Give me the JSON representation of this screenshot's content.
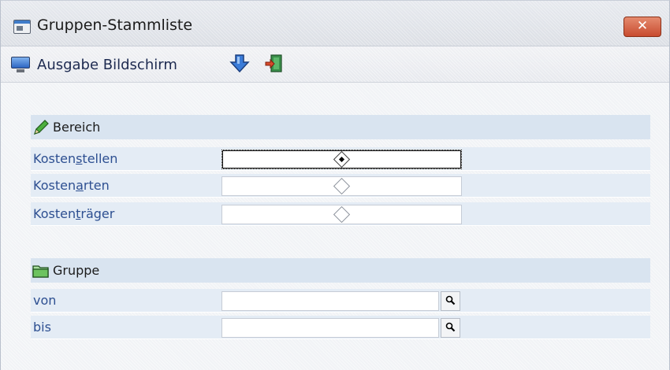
{
  "window": {
    "title": "Gruppen-Stammliste",
    "close_label": "✕"
  },
  "toolbar": {
    "output_label": "Ausgabe Bildschirm"
  },
  "sections": {
    "bereich": {
      "title": "Bereich",
      "options": [
        {
          "label_pre": "Kosten",
          "label_accel": "s",
          "label_post": "tellen",
          "selected": true
        },
        {
          "label_pre": "Kosten",
          "label_accel": "a",
          "label_post": "rten",
          "selected": false
        },
        {
          "label_pre": "Kosten",
          "label_accel": "t",
          "label_post": "räger",
          "selected": false
        }
      ]
    },
    "gruppe": {
      "title": "Gruppe",
      "from_label": "von",
      "from_value": "",
      "to_label": "bis",
      "to_value": ""
    }
  },
  "colors": {
    "section_header_bg": "#d9e4f0",
    "row_bg": "#e4ecf5",
    "label_text": "#2d4f91",
    "close_button": "#c84b2f"
  },
  "icons": {
    "app": "app-window-icon",
    "output": "monitor-icon",
    "export": "arrow-down-icon",
    "exit": "exit-door-icon",
    "bereich": "pencil-icon",
    "gruppe": "folder-icon",
    "search": "magnifier-icon"
  }
}
